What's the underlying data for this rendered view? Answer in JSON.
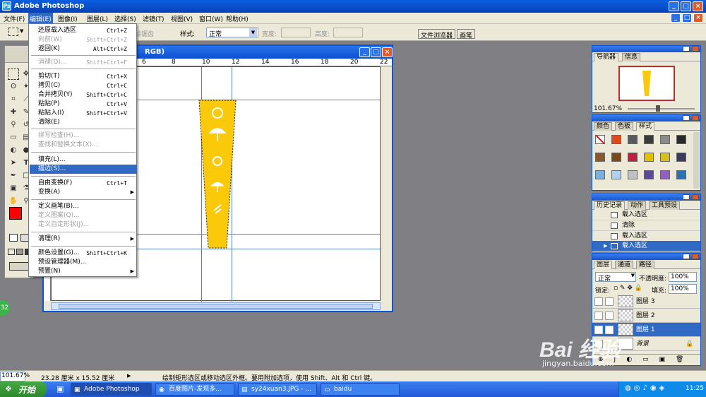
{
  "window": {
    "title": "Adobe Photoshop"
  },
  "menubar": [
    {
      "label": "文件(F)"
    },
    {
      "label": "编辑(E)"
    },
    {
      "label": "图像(I)"
    },
    {
      "label": "图层(L)"
    },
    {
      "label": "选择(S)"
    },
    {
      "label": "滤镜(T)"
    },
    {
      "label": "视图(V)"
    },
    {
      "label": "窗口(W)"
    },
    {
      "label": "帮助(H)"
    }
  ],
  "options": {
    "feather_partial": "除锯齿",
    "style_label": "样式:",
    "style_value": "正常",
    "width_label": "宽度:",
    "height_label": "高度:",
    "tab_file_browser": "文件浏览器",
    "tab_brushes": "画笔"
  },
  "document": {
    "title_fragment": "RGB)"
  },
  "ruler_numbers": [
    "6",
    "8",
    "10",
    "12",
    "14",
    "16",
    "18",
    "20",
    "22"
  ],
  "edit_menu": [
    {
      "label": "还原载入选区",
      "shortcut": "Ctrl+Z",
      "disabled": false
    },
    {
      "label": "向前(W)",
      "shortcut": "Shift+Ctrl+Z",
      "disabled": true
    },
    {
      "label": "返回(K)",
      "shortcut": "Alt+Ctrl+Z",
      "disabled": false
    },
    {
      "label": "消褪(D)...",
      "shortcut": "Shift+Ctrl+F",
      "disabled": true
    },
    {
      "label": "剪切(T)",
      "shortcut": "Ctrl+X",
      "disabled": false
    },
    {
      "label": "拷贝(C)",
      "shortcut": "Ctrl+C",
      "disabled": false
    },
    {
      "label": "合并拷贝(Y)",
      "shortcut": "Shift+Ctrl+C",
      "disabled": false
    },
    {
      "label": "粘贴(P)",
      "shortcut": "Ctrl+V",
      "disabled": false
    },
    {
      "label": "粘贴入(I)",
      "shortcut": "Shift+Ctrl+V",
      "disabled": false
    },
    {
      "label": "清除(E)",
      "shortcut": "",
      "disabled": false
    },
    {
      "label": "拼写检查(H)...",
      "shortcut": "",
      "disabled": true
    },
    {
      "label": "查找和替换文本(X)...",
      "shortcut": "",
      "disabled": true
    },
    {
      "label": "填充(L)...",
      "shortcut": "",
      "disabled": false
    },
    {
      "label": "描边(S)...",
      "shortcut": "",
      "disabled": false
    },
    {
      "label": "自由变换(F)",
      "shortcut": "Ctrl+T",
      "disabled": false
    },
    {
      "label": "变换(A)",
      "shortcut": "",
      "disabled": false
    },
    {
      "label": "定义画笔(B)...",
      "shortcut": "",
      "disabled": false
    },
    {
      "label": "定义图案(Q)...",
      "shortcut": "",
      "disabled": true
    },
    {
      "label": "定义自定形状(J)...",
      "shortcut": "",
      "disabled": true
    },
    {
      "label": "清理(R)",
      "shortcut": "",
      "disabled": false
    },
    {
      "label": "颜色设置(G)...",
      "shortcut": "Shift+Ctrl+K",
      "disabled": false
    },
    {
      "label": "预设管理器(M)...",
      "shortcut": "",
      "disabled": false
    },
    {
      "label": "预置(N)",
      "shortcut": "",
      "disabled": false
    }
  ],
  "navigator": {
    "tab_navigator": "导航器",
    "tab_info": "信息",
    "zoom": "101.67%"
  },
  "color_panel": {
    "tab_color": "颜色",
    "tab_swatches": "色板",
    "tab_styles": "样式"
  },
  "history": {
    "tab_history": "历史记录",
    "tab_actions": "动作",
    "tab_tool_presets": "工具预设",
    "items": [
      {
        "label": "载入选区"
      },
      {
        "label": "清除"
      },
      {
        "label": "载入选区"
      },
      {
        "label": "载入选区"
      }
    ]
  },
  "layers": {
    "tab_layers": "图层",
    "tab_channels": "通道",
    "tab_paths": "路径",
    "blend_mode": "正常",
    "opacity_label": "不透明度:",
    "opacity_value": "100%",
    "lock_label": "锁定:",
    "fill_label": "填充:",
    "fill_value": "100%",
    "items": [
      {
        "label": "图层 3"
      },
      {
        "label": "图层 2"
      },
      {
        "label": "图层 1"
      },
      {
        "label": "背景"
      }
    ]
  },
  "status": {
    "zoom": "101.67%",
    "doc_size": "23.28 厘米 x 15.52 厘米",
    "hint": "绘制矩形选区或移动选区外框。要用附加选项，使用 Shift、Alt 和 Ctrl 键。"
  },
  "taskbar": {
    "start": "开始",
    "tasks": [
      {
        "label": "Adobe Photoshop"
      },
      {
        "label": "百度图片-发现多..."
      },
      {
        "label": "sy24xuan3.JPG - ..."
      },
      {
        "label": "baidu"
      }
    ],
    "clock": "11:25"
  },
  "watermark": {
    "brand": "Bai 经验",
    "url": "jingyan.baidu.com"
  },
  "side_badge": "32",
  "colors": {
    "accent": "#316ac5",
    "titlebar": "#0a5fe0",
    "shape_fill": "#f9c90a",
    "foreground": "#ff0000"
  }
}
